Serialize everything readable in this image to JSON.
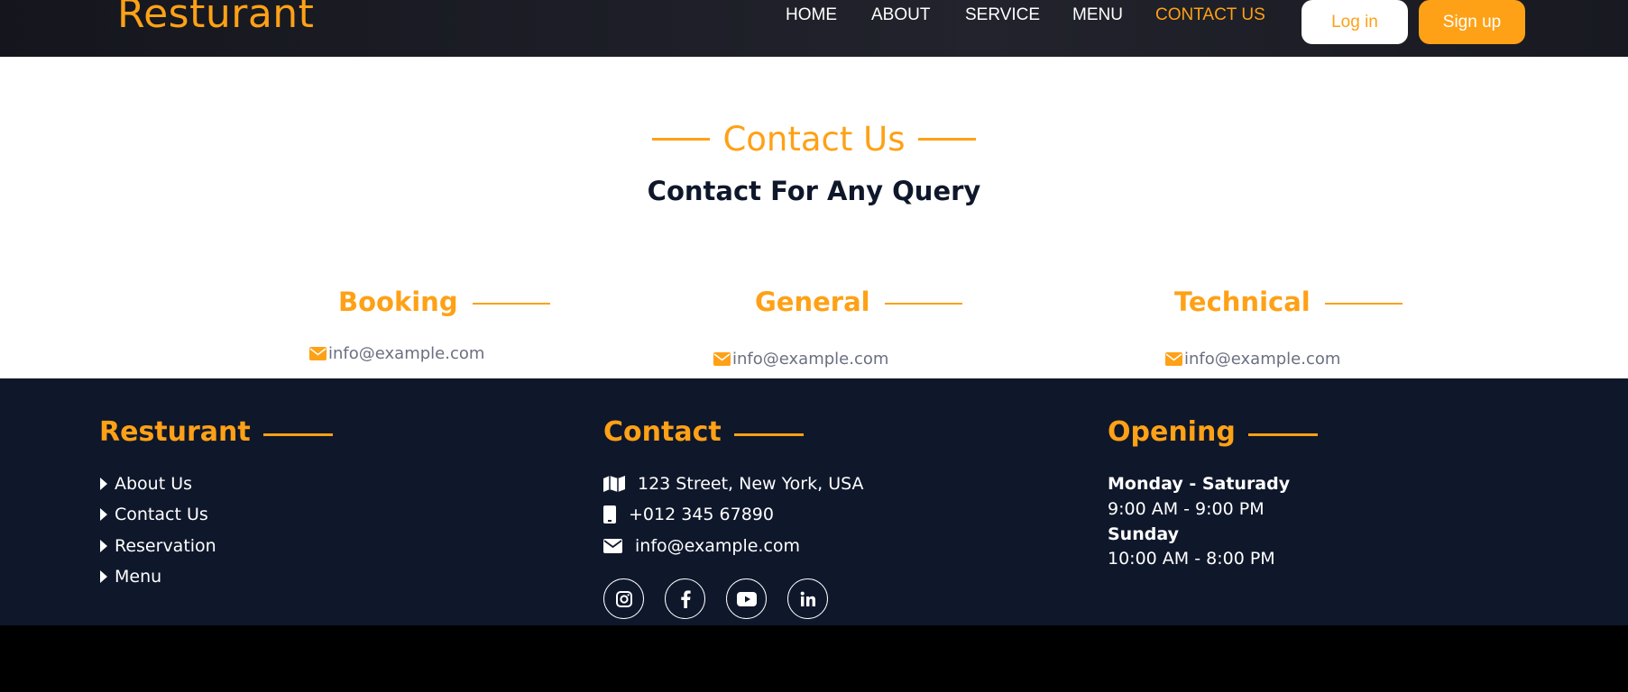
{
  "header": {
    "brand": "Resturant",
    "nav": [
      {
        "label": "HOME",
        "active": false
      },
      {
        "label": "ABOUT",
        "active": false
      },
      {
        "label": "SERVICE",
        "active": false
      },
      {
        "label": "MENU",
        "active": false
      },
      {
        "label": "CONTACT US",
        "active": true
      }
    ],
    "login_label": "Log in",
    "signup_label": "Sign up"
  },
  "contact": {
    "subtitle": "Contact Us",
    "title": "Contact For Any Query",
    "categories": [
      {
        "name": "Booking",
        "email": "info@example.com"
      },
      {
        "name": "General",
        "email": "info@example.com"
      },
      {
        "name": "Technical",
        "email": "info@example.com"
      }
    ]
  },
  "footer": {
    "brand_heading": "Resturant",
    "links": [
      "About Us",
      "Contact Us",
      "Reservation",
      "Menu"
    ],
    "contact_heading": "Contact",
    "address": "123 Street, New York, USA",
    "phone": "+012 345 67890",
    "email": "info@example.com",
    "social_icons": [
      "instagram-icon",
      "facebook-icon",
      "youtube-icon",
      "linkedin-icon"
    ],
    "opening_heading": "Opening",
    "schedule": [
      {
        "days": "Monday - Saturady",
        "hours": "9:00 AM - 9:00 PM"
      },
      {
        "days": "Sunday",
        "hours": "10:00 AM - 8:00 PM"
      }
    ]
  },
  "colors": {
    "accent": "#fea116",
    "dark": "#0f172b",
    "muted_text": "#6b6f80"
  }
}
